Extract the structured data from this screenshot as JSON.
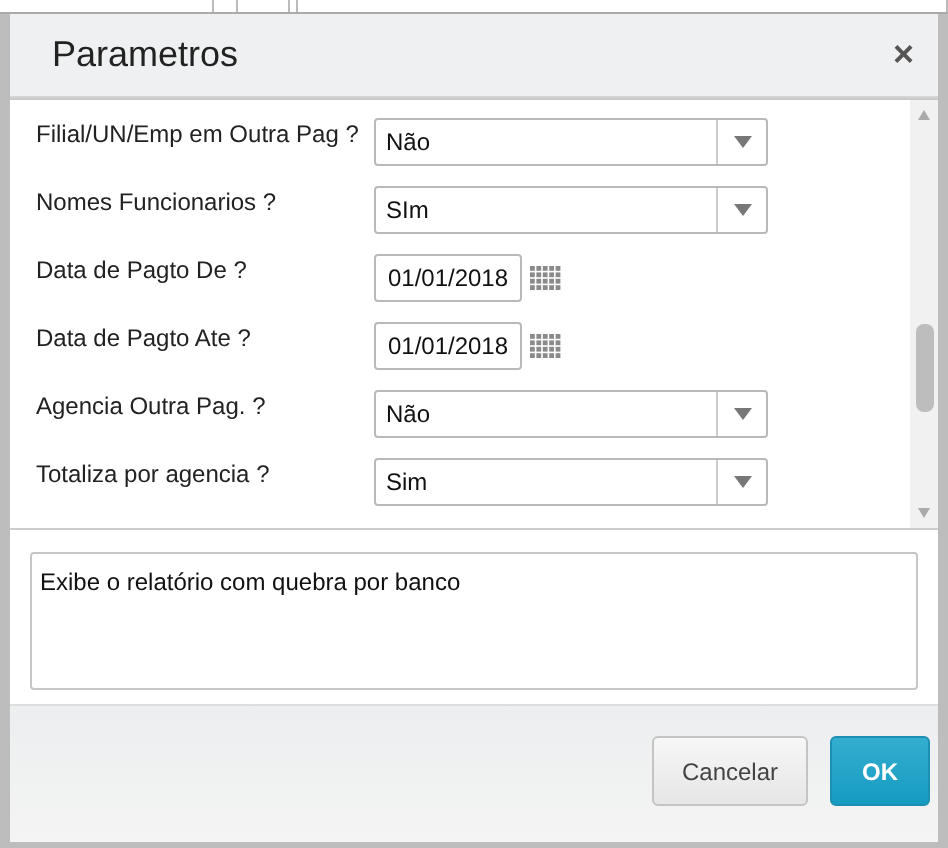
{
  "window": {
    "title": "Parametros",
    "close": "×"
  },
  "fields": [
    {
      "label": "Filial/UN/Emp em Outra Pag ?",
      "kind": "select",
      "value": "Não"
    },
    {
      "label": "Nomes Funcionarios ?",
      "kind": "select",
      "value": "SIm"
    },
    {
      "label": "Data de Pagto De ?",
      "kind": "date",
      "value": "01/01/2018"
    },
    {
      "label": "Data de Pagto Ate ?",
      "kind": "date",
      "value": "01/01/2018"
    },
    {
      "label": "Agencia Outra Pag. ?",
      "kind": "select",
      "value": "Não"
    },
    {
      "label": "Totaliza por agencia ?",
      "kind": "select",
      "value": "Sim"
    }
  ],
  "description": "Exibe o relatório com quebra por banco",
  "buttons": [
    {
      "label": "Cancelar",
      "kind": "secondary"
    },
    {
      "label": "OK",
      "kind": "primary"
    }
  ]
}
